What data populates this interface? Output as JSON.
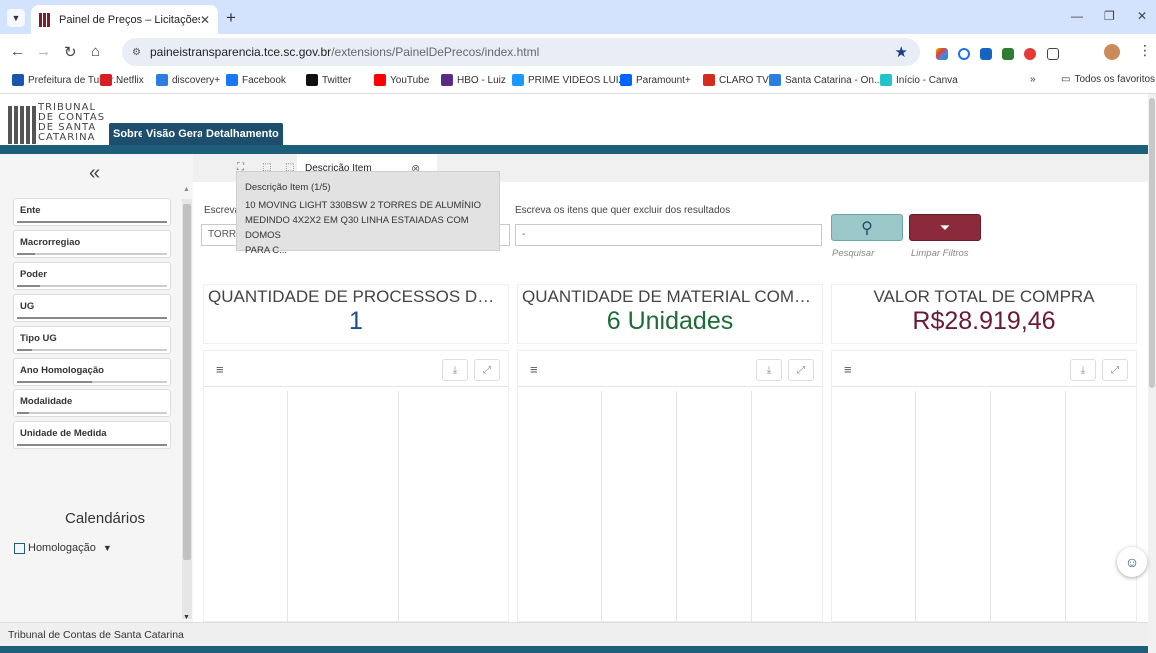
{
  "browser": {
    "tab_title": "Painel de Preços – Licitações",
    "url_host": "paineistransparencia.tce.sc.gov.br",
    "url_path": "/extensions/PainelDePrecos/index.html",
    "bookmarks": [
      {
        "label": "Prefeitura de Tubar...",
        "color": "#1a56b0"
      },
      {
        "label": "Netflix",
        "color": "#d81f26"
      },
      {
        "label": "discovery+",
        "color": "#2a7de1"
      },
      {
        "label": "Facebook",
        "color": "#1877f2"
      },
      {
        "label": "Twitter",
        "color": "#111111"
      },
      {
        "label": "YouTube",
        "color": "#ff0000"
      },
      {
        "label": "HBO - Luiz",
        "color": "#5b2a86"
      },
      {
        "label": "PRIME VIDEOS LUIZ",
        "color": "#1a98ff"
      },
      {
        "label": "Paramount+",
        "color": "#0064ff"
      },
      {
        "label": "CLARO TV",
        "color": "#d52b1e"
      },
      {
        "label": "Santa Catarina - On...",
        "color": "#2a7de1"
      },
      {
        "label": "Início - Canva",
        "color": "#20c4cb"
      }
    ],
    "more_bookmarks": "»",
    "all_favorites": "Todos os favoritos"
  },
  "header": {
    "logo_lines": [
      "TRIBUNAL",
      "DE CONTAS",
      "DE SANTA",
      "CATARINA"
    ],
    "tabs": [
      "Sobre",
      "Visão Geral",
      "Detalhamento"
    ]
  },
  "sidebar": {
    "collapse_glyph": "«",
    "filters": [
      {
        "label": "Ente",
        "fill": 1.0
      },
      {
        "label": "Macrorregiao",
        "fill": 0.12
      },
      {
        "label": "Poder",
        "fill": 0.15
      },
      {
        "label": "UG",
        "fill": 1.0
      },
      {
        "label": "Tipo UG",
        "fill": 0.1
      },
      {
        "label": "Ano Homologação",
        "fill": 0.5
      },
      {
        "label": "Modalidade",
        "fill": 0.08
      },
      {
        "label": "Unidade de Medida",
        "fill": 1.0
      }
    ],
    "calendars_title": "Calendários",
    "calendar_item": "Homologação"
  },
  "subtabs": {
    "active_label": "Descrição Item"
  },
  "search": {
    "include_label": "Escreva",
    "include_value": "TORRE",
    "exclude_label": "Escreva os itens que quer excluir dos resultados",
    "exclude_value": "-",
    "search_label": "Pesquisar",
    "clear_label": "Limpar Filtros"
  },
  "tooltip": {
    "title": "Descrição Item (1/5)",
    "line1": "10 MOVING LIGHT 330BSW 2 TORRES DE ALUMÍNIO",
    "line2": "MEDINDO 4X2X2 EM Q30 LINHA ESTAIADAS COM DOMOS",
    "line3": "PARA C..."
  },
  "kpis": [
    {
      "title": "QUANTIDADE DE PROCESSOS DE C...",
      "value": "1",
      "color": "#1d4f8a"
    },
    {
      "title": "QUANTIDADE DE MATERIAL COMPR...",
      "value": "6 Unidades",
      "color": "#1e6b3a"
    },
    {
      "title": "VALOR TOTAL DE COMPRA",
      "value": "R$28.919,46",
      "color": "#6b1a34"
    }
  ],
  "footer": {
    "text": "Tribunal de Contas de Santa Catarina"
  },
  "colors": {
    "brand_teal": "#1d5e7a",
    "search_btn": "#9cc7c9",
    "clear_btn": "#8b2a3a"
  }
}
